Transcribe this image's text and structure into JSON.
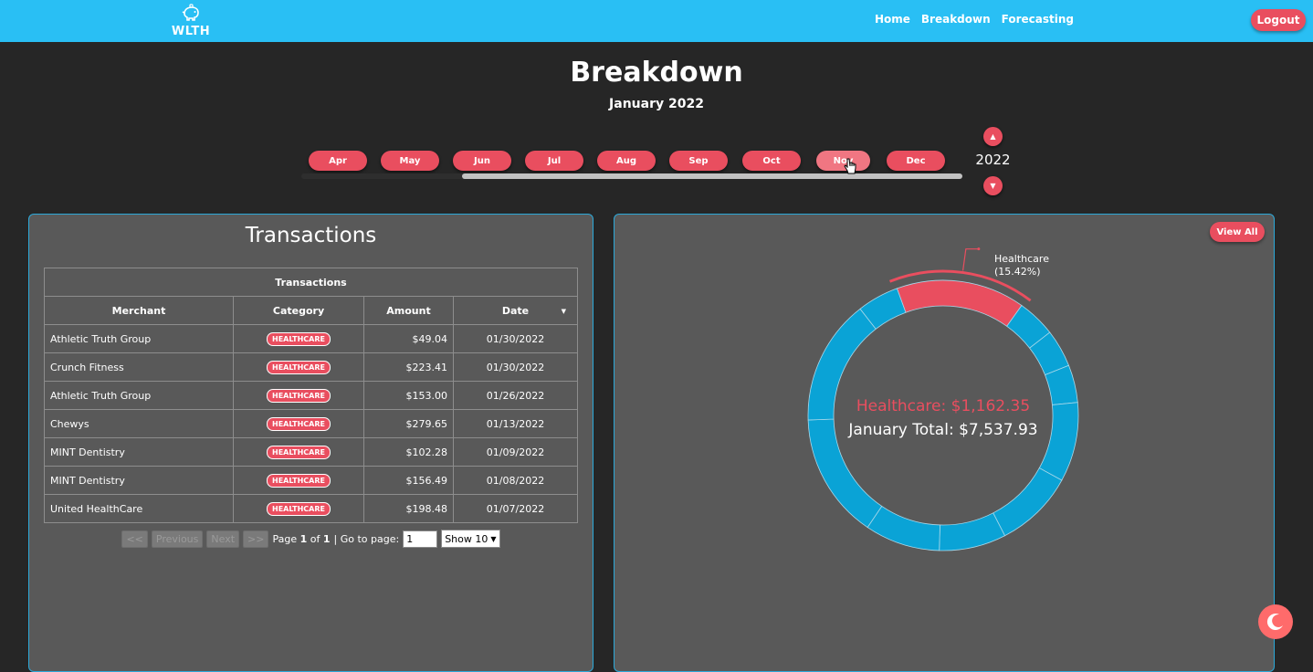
{
  "app": {
    "logo_text": "WLTH",
    "accent": "#e94e5f",
    "nav_bg": "#29bff4"
  },
  "nav": {
    "links": [
      "Home",
      "Breakdown",
      "Forecasting"
    ],
    "logout": "Logout"
  },
  "page": {
    "title": "Breakdown",
    "subtitle": "January 2022"
  },
  "month_selector": {
    "months": [
      "Apr",
      "May",
      "Jun",
      "Jul",
      "Aug",
      "Sep",
      "Oct",
      "Nov",
      "Dec"
    ],
    "hovered": "Nov",
    "year": "2022"
  },
  "transactions": {
    "panel_title": "Transactions",
    "table_caption": "Transactions",
    "columns": [
      "Merchant",
      "Category",
      "Amount",
      "Date"
    ],
    "rows": [
      {
        "merchant": "Athletic Truth Group",
        "category": "HEALTHCARE",
        "amount": "$49.04",
        "date": "01/30/2022"
      },
      {
        "merchant": "Crunch Fitness",
        "category": "HEALTHCARE",
        "amount": "$223.41",
        "date": "01/30/2022"
      },
      {
        "merchant": "Athletic Truth Group",
        "category": "HEALTHCARE",
        "amount": "$153.00",
        "date": "01/26/2022"
      },
      {
        "merchant": "Chewys",
        "category": "HEALTHCARE",
        "amount": "$279.65",
        "date": "01/13/2022"
      },
      {
        "merchant": "MINT Dentistry",
        "category": "HEALTHCARE",
        "amount": "$102.28",
        "date": "01/09/2022"
      },
      {
        "merchant": "MINT Dentistry",
        "category": "HEALTHCARE",
        "amount": "$156.49",
        "date": "01/08/2022"
      },
      {
        "merchant": "United HealthCare",
        "category": "HEALTHCARE",
        "amount": "$198.48",
        "date": "01/07/2022"
      }
    ],
    "pagination": {
      "first": "<<",
      "previous": "Previous",
      "next": "Next",
      "last": ">>",
      "page_prefix": "Page",
      "page_current": "1",
      "page_of": "of",
      "page_total": "1",
      "goto_label": "| Go to page:",
      "goto_value": "1",
      "show": "Show 10"
    }
  },
  "breakdown": {
    "view_all": "View All",
    "highlight_label": "Healthcare",
    "highlight_pct": "(15.42%)",
    "center_category": "Healthcare: $1,162.35",
    "center_total": "January Total: $7,537.93"
  },
  "chart_data": {
    "type": "pie",
    "style": "donut",
    "categories": [
      "Healthcare",
      "",
      "",
      "",
      "",
      "",
      "",
      "",
      "",
      "",
      ""
    ],
    "values": [
      15.42,
      4.6,
      4.5,
      4.5,
      9.5,
      9.5,
      8.0,
      9.0,
      15.0,
      15.0,
      4.98
    ],
    "colors": {
      "highlight": "#e94e5f",
      "other": "#0aa3d6"
    },
    "annotations": [
      {
        "label": "Healthcare",
        "value": "(15.42%)"
      }
    ],
    "center_text": [
      "Healthcare: $1,162.35",
      "January Total: $7,537.93"
    ]
  }
}
